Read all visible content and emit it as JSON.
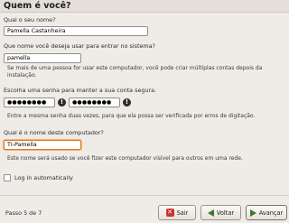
{
  "window": {
    "title": "Quem é você?"
  },
  "name": {
    "label": "Qual o seu nome?",
    "value": "Pamella Castanheira"
  },
  "username": {
    "label": "Que nome você deseja usar para entrar no sistema?",
    "value": "pamella",
    "hint": "Se mais de uma pessoa for usar este computador, você pode criar múltiplas contas depois da instalação."
  },
  "password": {
    "label": "Escolha uma senha para manter a sua conta segura.",
    "value1": "●●●●●●●●",
    "value2": "●●●●●●●●",
    "hint": "Entre a mesma senha duas vezes, para que ela possa ser verificada por erros de digitação."
  },
  "computer": {
    "label": "Qual é o nome deste computador?",
    "value": "TI-Pamella",
    "hint": "Este nome será usado se você fizer este computador visível para outros em uma rede."
  },
  "autologin": {
    "label": "Log in automatically",
    "checked": false
  },
  "footer": {
    "step": "Passo 5 de 7",
    "quit": "Sair",
    "back": "Voltar",
    "forward": "Avançar"
  }
}
